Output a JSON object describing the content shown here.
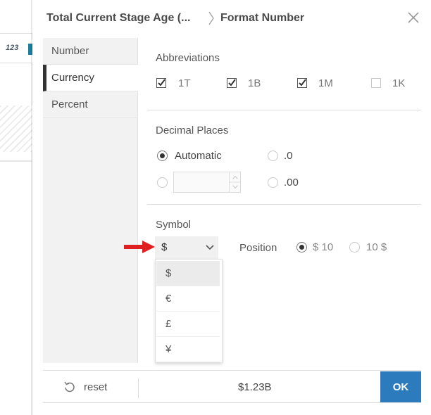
{
  "background": {
    "badge": "123"
  },
  "header": {
    "breadcrumb_parent": "Total Current Stage Age (...",
    "breadcrumb_current": "Format Number",
    "close_icon": "close-icon"
  },
  "nav": {
    "items": [
      {
        "label": "Number",
        "active": false
      },
      {
        "label": "Currency",
        "active": true
      },
      {
        "label": "Percent",
        "active": false
      }
    ]
  },
  "abbreviations": {
    "title": "Abbreviations",
    "options": [
      {
        "label": "1T",
        "checked": true
      },
      {
        "label": "1B",
        "checked": true
      },
      {
        "label": "1M",
        "checked": true
      },
      {
        "label": "1K",
        "checked": false
      }
    ]
  },
  "decimal_places": {
    "title": "Decimal Places",
    "options": [
      {
        "label": "Automatic",
        "checked": true
      },
      {
        "label": ".0",
        "checked": false
      },
      {
        "label": "",
        "checked": false,
        "custom_input": true
      },
      {
        "label": ".00",
        "checked": false
      }
    ],
    "custom_value": ""
  },
  "symbol": {
    "title": "Symbol",
    "selected": "$",
    "options": [
      "$",
      "€",
      "£",
      "¥"
    ],
    "position_label": "Position",
    "position_options": [
      {
        "label": "$ 10",
        "checked": true
      },
      {
        "label": "10 $",
        "checked": false
      }
    ]
  },
  "footer": {
    "reset_label": "reset",
    "preview": "$1.23B",
    "ok_label": "OK"
  },
  "colors": {
    "accent": "#2b7bbd",
    "arrow": "#e02020",
    "text": "#333333"
  }
}
